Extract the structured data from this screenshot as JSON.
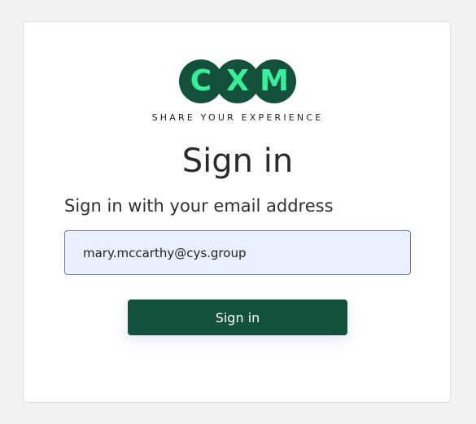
{
  "logo": {
    "letters": [
      "C",
      "X",
      "M"
    ],
    "tagline": "SHARE YOUR EXPERIENCE"
  },
  "form": {
    "title": "Sign in",
    "prompt": "Sign in with your email address",
    "email_value": "mary.mccarthy@cys.group",
    "button_label": "Sign in"
  },
  "colors": {
    "brand_dark_green": "#14513d",
    "brand_light_green": "#37ef9a",
    "input_background": "#e8f0fe",
    "page_background": "#f2f2f2"
  }
}
